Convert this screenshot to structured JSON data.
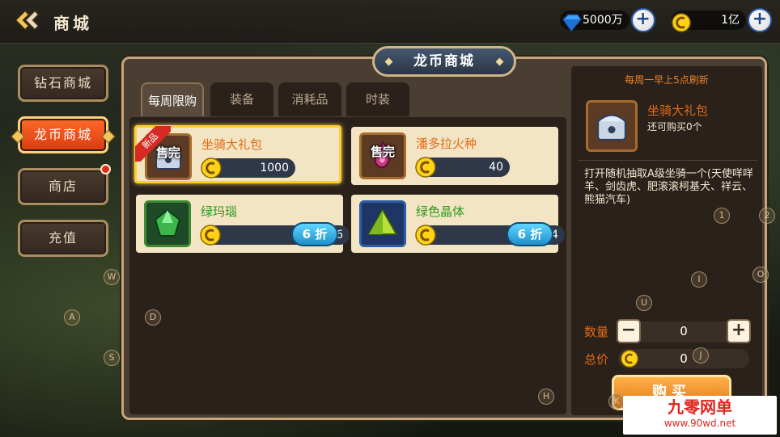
{
  "header": {
    "title": "商城",
    "diamond_amount": "5000万",
    "coin_amount": "1亿"
  },
  "nav": {
    "items": [
      {
        "label": "钻石商城"
      },
      {
        "label": "龙币商城"
      },
      {
        "label": "商店"
      },
      {
        "label": "充值"
      }
    ],
    "active_index": 1
  },
  "panel": {
    "title": "龙币商城",
    "tabs": [
      {
        "label": "每周限购"
      },
      {
        "label": "装备"
      },
      {
        "label": "消耗品"
      },
      {
        "label": "时装"
      }
    ]
  },
  "items": [
    {
      "name": "坐骑大礼包",
      "price": "1000",
      "badge": "新品",
      "sold_out": "售完"
    },
    {
      "name": "潘多拉火种",
      "price": "40",
      "sold_out": "售完"
    },
    {
      "name": "绿玛瑙",
      "price": "6",
      "discount": "6 折"
    },
    {
      "name": "绿色晶体",
      "price": "24",
      "discount": "6 折"
    }
  ],
  "detail": {
    "refresh_note": "每周一早上5点刷新",
    "name": "坐骑大礼包",
    "limit": "还可购买0个",
    "description": "打开随机抽取A级坐骑一个(天使咩咩羊、剑齿虎、肥滚滚柯基犬、祥云、熊猫汽车)",
    "qty_label": "数量",
    "qty_value": "0",
    "total_label": "总价",
    "total_value": "0",
    "buy_label": "购买"
  },
  "key_hints": [
    "W",
    "A",
    "S",
    "D",
    "1",
    "2",
    "I",
    "O",
    "U",
    "J",
    "H",
    "K"
  ],
  "watermark": {
    "title": "九零网单",
    "url": "www.90wd.net"
  },
  "colors": {
    "accent_orange": "#e36a14",
    "name_green": "#2f9a1e",
    "active_nav": "#ff6a2a",
    "selected_border": "#ffcd2a",
    "discount_blue": "#1f8fc9"
  }
}
